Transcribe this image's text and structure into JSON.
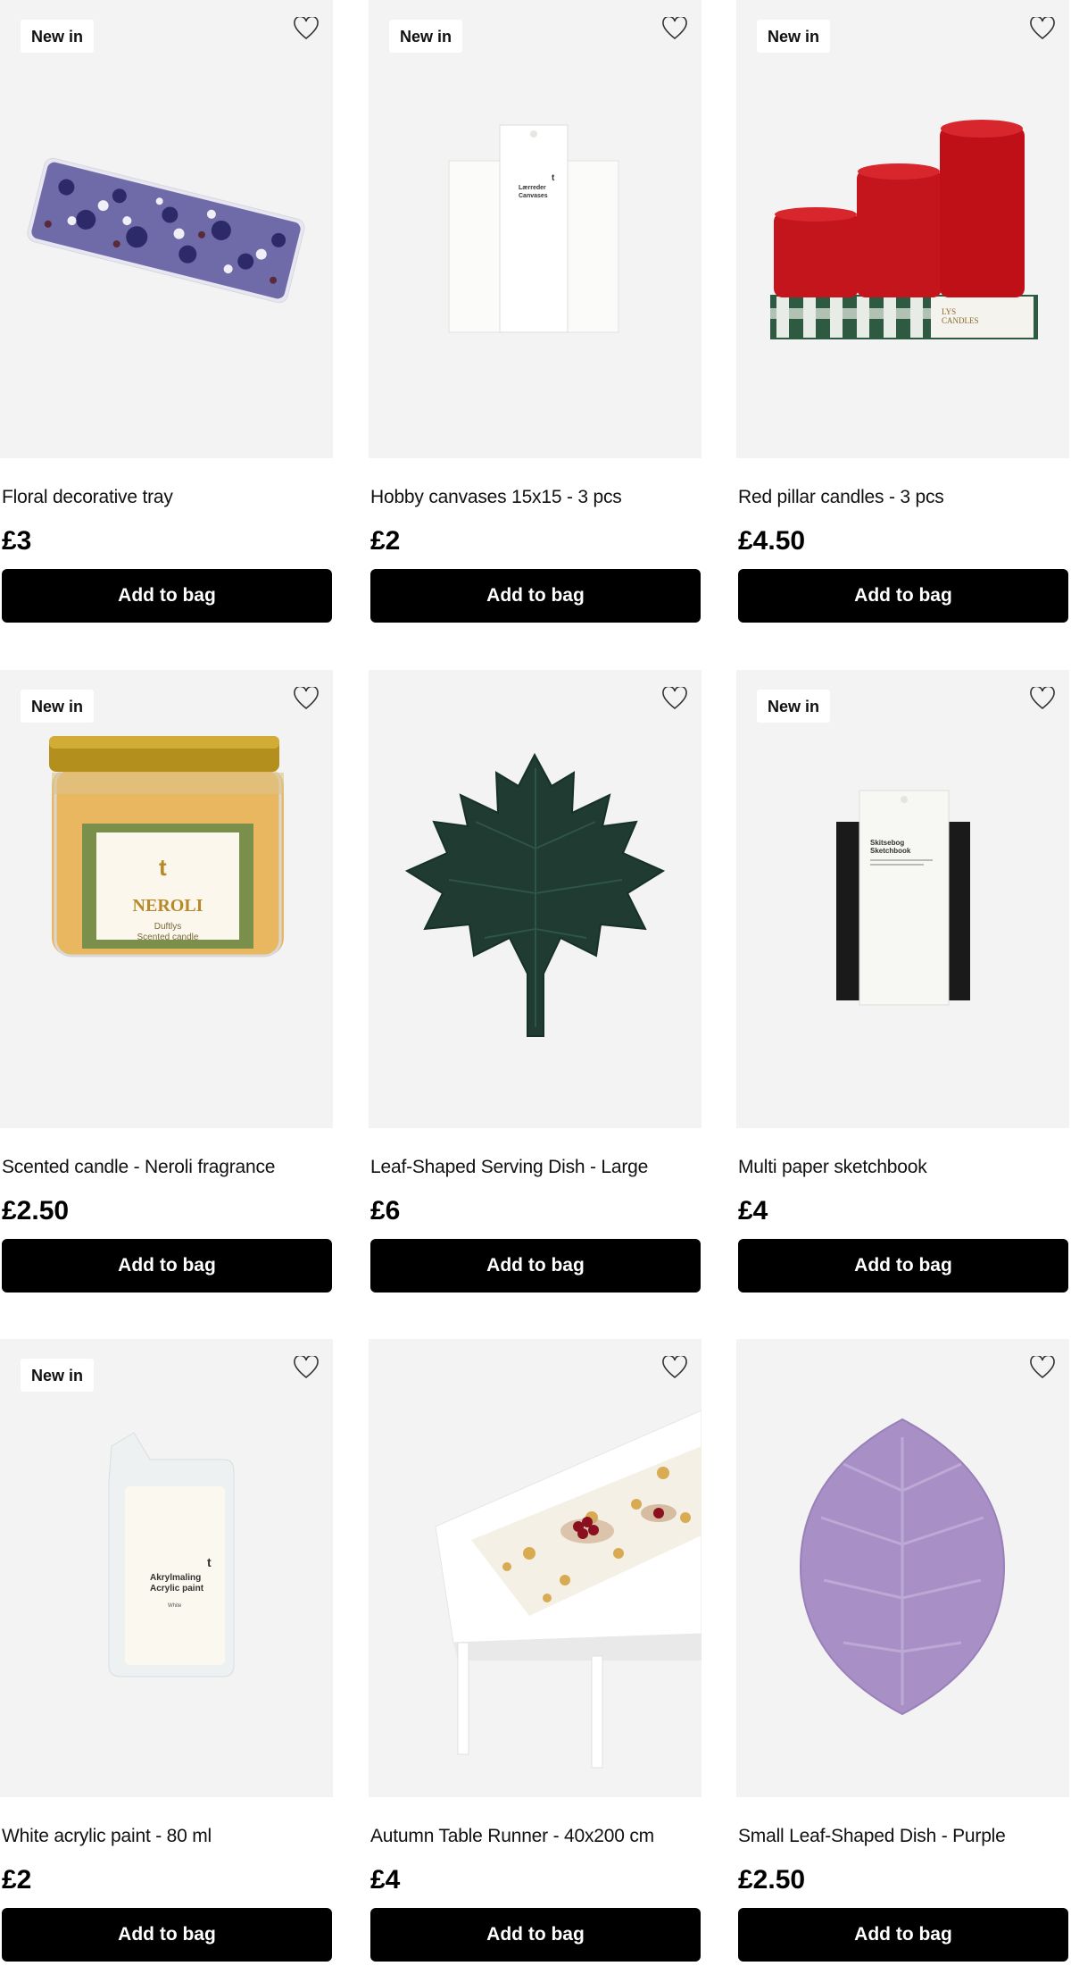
{
  "products": [
    {
      "name": "Floral decorative tray",
      "price": "£3",
      "badge": "New in",
      "button": "Add to bag"
    },
    {
      "name": "Hobby canvases 15x15 - 3 pcs",
      "price": "£2",
      "badge": "New in",
      "button": "Add to bag",
      "image_text": [
        "Lærreder",
        "Canvases"
      ]
    },
    {
      "name": "Red pillar candles - 3 pcs",
      "price": "£4.50",
      "badge": "New in",
      "button": "Add to bag",
      "image_text": [
        "LYS",
        "CANDLES"
      ]
    },
    {
      "name": "Scented candle - Neroli fragrance",
      "price": "£2.50",
      "badge": "New in",
      "button": "Add to bag",
      "image_text": [
        "NEROLI",
        "Duftlys",
        "Scented candle"
      ]
    },
    {
      "name": "Leaf-Shaped Serving Dish - Large",
      "price": "£6",
      "badge": "",
      "button": "Add to bag"
    },
    {
      "name": "Multi paper sketchbook",
      "price": "£4",
      "badge": "New in",
      "button": "Add to bag",
      "image_text": [
        "Skitsebog",
        "Sketchbook"
      ]
    },
    {
      "name": "White acrylic paint - 80 ml",
      "price": "£2",
      "badge": "New in",
      "button": "Add to bag",
      "image_text": [
        "Akrylmaling",
        "Acrylic paint",
        "White"
      ]
    },
    {
      "name": "Autumn Table Runner - 40x200 cm",
      "price": "£4",
      "badge": "",
      "button": "Add to bag"
    },
    {
      "name": "Small Leaf-Shaped Dish - Purple",
      "price": "£2.50",
      "badge": "",
      "button": "Add to bag"
    }
  ],
  "icons": {
    "wishlist": "heart-outline-icon"
  },
  "colors": {
    "button_bg": "#000000",
    "card_bg": "#f3f3f3",
    "candle_red": "#c4141c",
    "leaf_green": "#1f3b32",
    "leaf_purple": "#a88fc6"
  }
}
